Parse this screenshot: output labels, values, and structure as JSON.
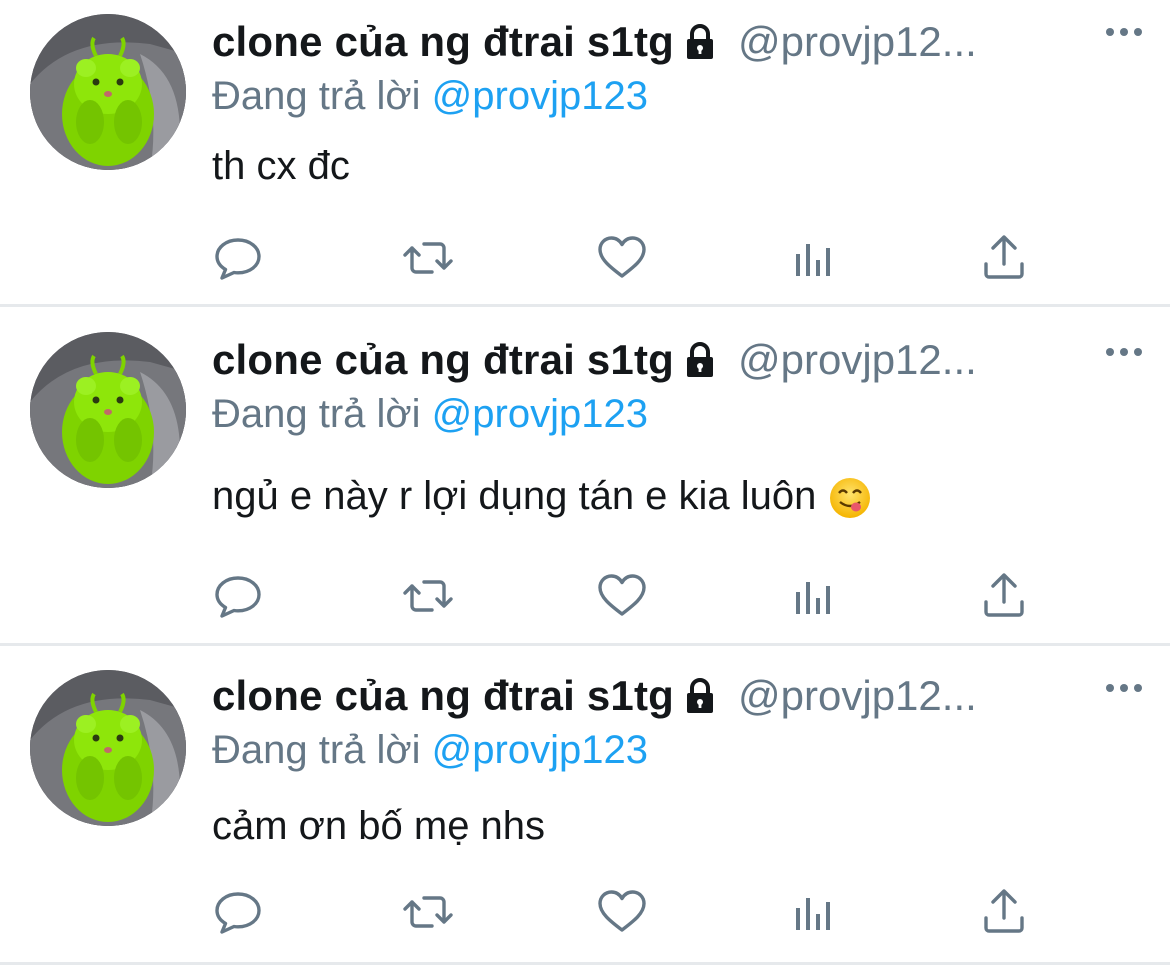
{
  "tweets": [
    {
      "name": "clone của ng đtrai s1tg",
      "handle": "@provjp12...",
      "reply_prefix": "Đang trả lời",
      "reply_to": "@provjp123",
      "text": "th cx đc",
      "has_emoji": false
    },
    {
      "name": "clone của ng đtrai s1tg",
      "handle": "@provjp12...",
      "reply_prefix": "Đang trả lời",
      "reply_to": "@provjp123",
      "text": "ngủ e này r lợi dụng tán e kia luôn",
      "has_emoji": true
    },
    {
      "name": "clone của ng đtrai s1tg",
      "handle": "@provjp12...",
      "reply_prefix": "Đang trả lời",
      "reply_to": "@provjp123",
      "text": "cảm ơn bố mẹ nhs",
      "has_emoji": false
    }
  ],
  "icons": {
    "lock": "lock-icon",
    "more": "more-options-icon",
    "reply": "reply-icon",
    "retweet": "retweet-icon",
    "like": "like-icon",
    "analytics": "analytics-icon",
    "share": "share-icon",
    "emoji": "yum-face-emoji"
  },
  "colors": {
    "name": "#14171a",
    "secondary": "#657786",
    "link": "#1da1f2",
    "separator": "#e6e9ec",
    "avatar_hamster": "#8ee000"
  }
}
